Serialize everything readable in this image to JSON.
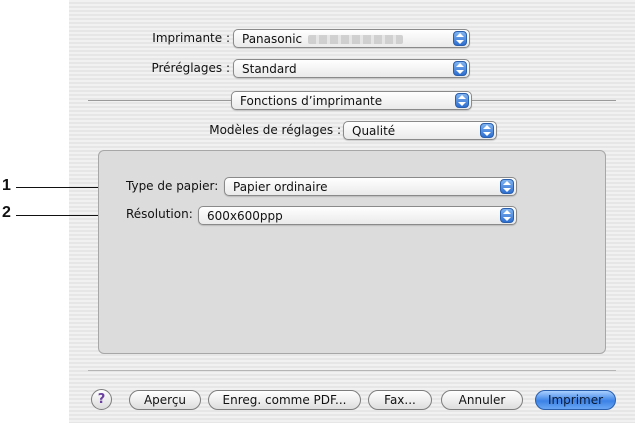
{
  "annotations": {
    "pointer_1": "1",
    "pointer_2": "2"
  },
  "printer": {
    "label": "Imprimante :",
    "value": "Panasonic"
  },
  "presets": {
    "label": "Préréglages :",
    "value": "Standard"
  },
  "panel_menu": {
    "value": "Fonctions d’imprimante"
  },
  "settings_template": {
    "label": "Modèles de réglages :",
    "value": "Qualité"
  },
  "paper_type": {
    "label": "Type de papier:",
    "value": "Papier ordinaire"
  },
  "resolution": {
    "label": "Résolution:",
    "value": "600x600ppp"
  },
  "buttons": {
    "help": "?",
    "preview": "Aperçu",
    "save_pdf": "Enreg. comme PDF...",
    "fax": "Fax...",
    "cancel": "Annuler",
    "print": "Imprimer"
  },
  "colors": {
    "accent": "#3b82e6",
    "panel": "#dcdcdc"
  }
}
